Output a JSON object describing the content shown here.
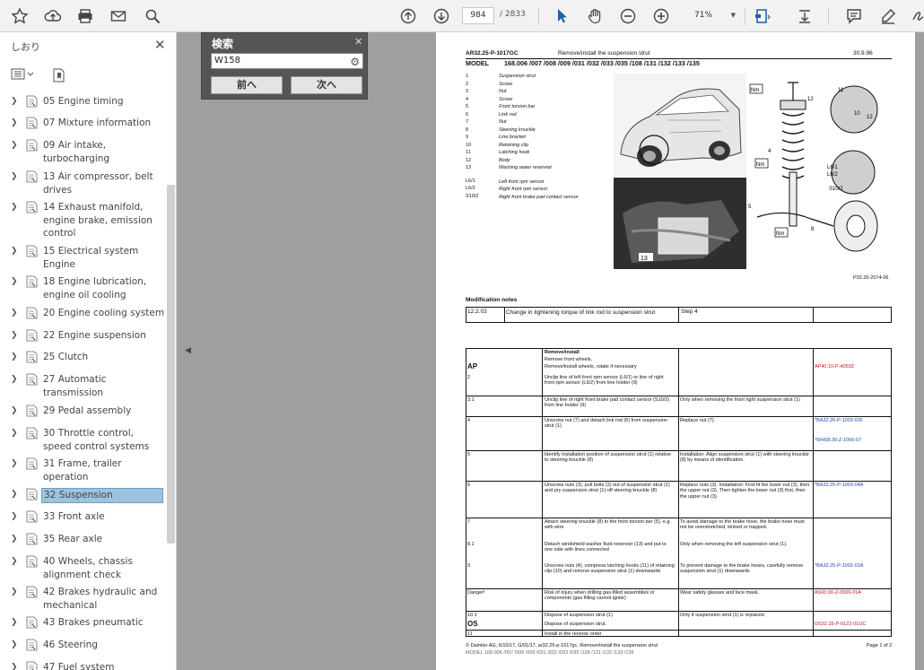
{
  "toolbar": {
    "page_current": "984",
    "page_total": "/ 2833",
    "zoom": "71%"
  },
  "sidebar": {
    "title": "しおり",
    "items": [
      {
        "label": "05 Engine timing"
      },
      {
        "label": "07 Mixture information"
      },
      {
        "label": "09 Air intake, turbocharging"
      },
      {
        "label": "13 Air compressor, belt drives"
      },
      {
        "label": "14 Exhaust manifold, engine brake, emission control"
      },
      {
        "label": "15 Electrical system Engine"
      },
      {
        "label": "18 Engine lubrication, engine oil cooling"
      },
      {
        "label": "20 Engine cooling system"
      },
      {
        "label": "22 Engine suspension"
      },
      {
        "label": "25 Clutch"
      },
      {
        "label": "27 Automatic transmission"
      },
      {
        "label": "29 Pedal assembly"
      },
      {
        "label": "30 Throttle control, speed control systems"
      },
      {
        "label": "31 Frame, trailer operation"
      },
      {
        "label": "32 Suspension"
      },
      {
        "label": "33 Front axle"
      },
      {
        "label": "35 Rear axle"
      },
      {
        "label": "40 Wheels, chassis alignment check"
      },
      {
        "label": "42 Brakes hydraulic and mechanical"
      },
      {
        "label": "43 Brakes pneumatic"
      },
      {
        "label": "46 Steering"
      },
      {
        "label": "47 Fuel system"
      }
    ]
  },
  "find": {
    "title": "検索",
    "value": "W158",
    "prev": "前へ",
    "next": "次へ"
  },
  "doc": {
    "header_code": "AR32.25-P-1017GC",
    "header_title": "Remove/install the suspension strut",
    "header_date": "30.9.96",
    "model_label": "MODEL",
    "model_value": "168.006 /007 /008 /009 /031 /032 /033 /035 /108 /131 /132 /133 /135",
    "parts": [
      {
        "n": "1",
        "name": "Suspension strut"
      },
      {
        "n": "2",
        "name": "Screw"
      },
      {
        "n": "3",
        "name": "Nut"
      },
      {
        "n": "4",
        "name": "Screw"
      },
      {
        "n": "5",
        "name": "Front torsion bar"
      },
      {
        "n": "6",
        "name": "Link rod"
      },
      {
        "n": "7",
        "name": "Nut"
      },
      {
        "n": "8",
        "name": "Steering knuckle"
      },
      {
        "n": "9",
        "name": "Line bracket"
      },
      {
        "n": "10",
        "name": "Retaining clip"
      },
      {
        "n": "11",
        "name": "Latching hook"
      },
      {
        "n": "12",
        "name": "Body"
      },
      {
        "n": "13",
        "name": "Washing water reservoir"
      }
    ],
    "sensors": [
      {
        "n": "L6/1",
        "name": "Left front rpm sensor"
      },
      {
        "n": "L6/2",
        "name": "Right front rpm sensor"
      },
      {
        "n": "S10/2",
        "name": "Right front brake pad contact sensor"
      }
    ],
    "figure_code": "P32.25-2074-06",
    "mod_title": "Modification notes",
    "mod_date": "12.2.03",
    "mod_text": "Change in tightening torque of link rod to suspension strut",
    "mod_step": "Step 4",
    "steps": [
      {
        "col1": "",
        "col2": "Remove/install",
        "col3": "",
        "col4": ""
      },
      {
        "col1": "",
        "col2": "Remove front wheels.",
        "col3": "",
        "col4": ""
      },
      {
        "col1": "AP",
        "col2": "Remove/install wheels, rotate if necessary",
        "col3": "",
        "col4": "AP40.10-P-4050Z"
      },
      {
        "col1": "2",
        "col2": "Unclip line of left front rpm sensor (L6/1) or line of right front rpm sensor (L6/2) from line holder (9)",
        "col3": "",
        "col4": ""
      },
      {
        "col1": "3.1",
        "col2": "Unclip line of right front brake pad contact sensor (S10/2) from line holder (9)",
        "col3": "Only when removing the front right suspension strut (1)",
        "col4": ""
      },
      {
        "col1": "4",
        "col2": "Unscrew nut (7) and detach link rod (6) from suspension strut (1)",
        "col3": "Replace nut (7).",
        "col4": "*BA32.20-P-1003-02F"
      },
      {
        "col1": "",
        "col2": "",
        "col3": "",
        "col4": "*WH58.30-Z-1000-07"
      },
      {
        "col1": "5",
        "col2": "Identify installation position of suspension strut (1) relative to steering knuckle (8)",
        "col3": "Installation: Align suspension strut (1) with steering knuckle (8) by means of identification.",
        "col4": ""
      },
      {
        "col1": "6",
        "col2": "Unscrew nuts (3), pull bolts (2) out of suspension strut (1) and pry suspension strut (1) off steering knuckle (8)",
        "col3": "Replace nuts (3). Installation: First fit the lower nut (3), then the upper nut (3). Then tighten the lower nut (3) first, then the upper nut (3).",
        "col4": "*BA32.25-P-1003-04A"
      },
      {
        "col1": "7",
        "col2": "Attach steering knuckle (8) to the front torsion bar (5), e.g. with wire",
        "col3": "To avoid damage to the brake hose, the brake hose must not be overstretched, kinked or trapped.",
        "col4": ""
      },
      {
        "col1": "8.1",
        "col2": "Detach windshield washer fluid reservoir (13) and put to one side with lines connected",
        "col3": "Only when removing the left suspension strut (1).",
        "col4": ""
      },
      {
        "col1": "9",
        "col2": "Unscrew nuts (4), compress latching hooks (11) of retaining clip (10) and remove suspension strut (1) downwards",
        "col3": "To prevent damage to the brake hoses, carefully remove suspension strut (1) downwards",
        "col4": "*BA32.25-P-1002-01A"
      },
      {
        "col1": "Danger!",
        "col2": "Risk of injury when drilling gas-filled assemblies or components (gas filling cannot ignite)",
        "col3": "Wear safety glasses and face mask.",
        "col4": "AS00.00-Z-0006-01A"
      },
      {
        "col1": "10.1",
        "col2": "Dispose of suspension strut (1)",
        "col3": "Only if suspension strut (1) is replaced.",
        "col4": ""
      },
      {
        "col1": "OS",
        "col2": "Dispose of suspension strut.",
        "col3": "",
        "col4": "OS32.25-P-0122-01GC"
      },
      {
        "col1": "11",
        "col2": "Install in the reverse order",
        "col3": "",
        "col4": ""
      }
    ],
    "footer_left": "© Daimler AG, 6/10/17, G/01/17, ar32.25-p-1017gc, Remove/install the suspension strut",
    "footer_left2": "MODEL 168.006 /007 /008 /009 /031 /032 /033 /035 /108 /131 /132 /133 /135",
    "footer_right": "Page 1 of 2"
  }
}
